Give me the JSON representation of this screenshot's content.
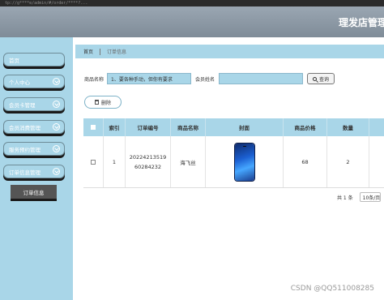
{
  "topbar": {
    "url_text": "tp://g****e/admin/#/order/****?..."
  },
  "header": {
    "title": "理发店管理"
  },
  "sidebar": {
    "items": [
      {
        "label": "首页"
      },
      {
        "label": "个人中心"
      },
      {
        "label": "会员卡管理"
      },
      {
        "label": "会员消费管理"
      },
      {
        "label": "服务预约管理"
      },
      {
        "label": "订单信息管理"
      }
    ],
    "sub_item": "订单信息"
  },
  "breadcrumb": {
    "home": "首页",
    "current": "订单信息"
  },
  "search": {
    "product_label": "商品名称",
    "product_value": "1、要各种手动，但你有要求",
    "member_label": "会员姓名",
    "member_placeholder": "会员姓名",
    "button": "查询"
  },
  "actions": {
    "delete": "删除"
  },
  "table": {
    "headers": [
      "索引",
      "订单编号",
      "商品名称",
      "封面",
      "商品价格",
      "数量"
    ],
    "rows": [
      {
        "index": "1",
        "order_no_1": "20224213519",
        "order_no_2": "60284232",
        "product": "海飞丝",
        "cover": "phone-image",
        "price": "68",
        "qty": "2"
      }
    ]
  },
  "pager": {
    "total": "共 1 条",
    "page_size": "10条/页"
  },
  "watermark": "CSDN @QQ511008285",
  "colors": {
    "accent": "#a9d6e8",
    "header": "#8a96a2",
    "sub_active": "#555555"
  }
}
